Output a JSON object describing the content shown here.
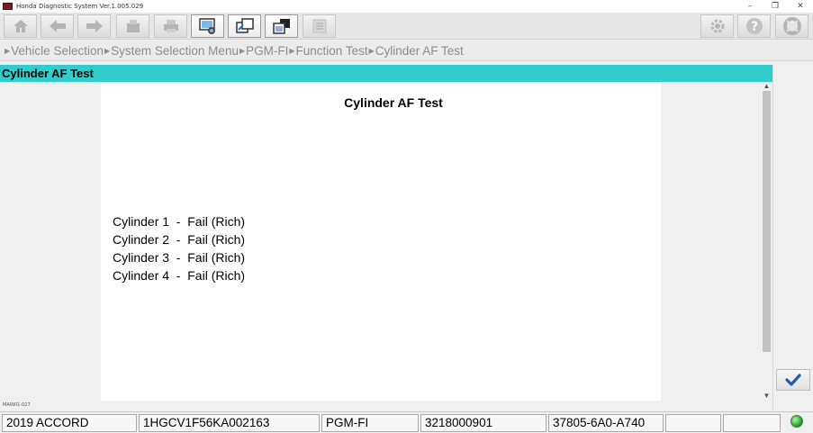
{
  "window": {
    "title": "Honda Diagnostic System Ver.1.005.029",
    "controls": [
      "–",
      "❐",
      "✕"
    ]
  },
  "toolbar": {
    "buttons": [
      {
        "name": "home-button",
        "icon": "home-icon"
      },
      {
        "name": "back-button",
        "icon": "arrow-left-icon"
      },
      {
        "name": "forward-button",
        "icon": "arrow-right-icon"
      },
      {
        "name": "save-button",
        "icon": "save-icon"
      },
      {
        "name": "print-button",
        "icon": "printer-icon"
      },
      {
        "name": "screenshot-button",
        "icon": "screen-capture-icon"
      },
      {
        "name": "switch-view-button",
        "icon": "window-switch-icon"
      },
      {
        "name": "window-stack-button",
        "icon": "window-stack-icon"
      },
      {
        "name": "data-button",
        "icon": "data-grid-icon"
      },
      {
        "name": "settings-button",
        "icon": "gear-icon"
      },
      {
        "name": "help-button",
        "icon": "help-icon"
      },
      {
        "name": "exit-button",
        "icon": "lifebuoy-icon"
      }
    ]
  },
  "breadcrumb": [
    "Vehicle Selection",
    "System Selection Menu",
    "PGM-FI",
    "Function Test",
    "Cylinder AF Test"
  ],
  "section_header": "Cylinder AF Test",
  "panel_code": "MAIN01-027",
  "content": {
    "title": "Cylinder AF Test",
    "results": [
      "Cylinder 1  -  Fail (Rich)",
      "Cylinder 2  -  Fail (Rich)",
      "Cylinder 3  -  Fail (Rich)",
      "Cylinder 4  -  Fail (Rich)"
    ]
  },
  "ok_button_icon": "checkmark-icon",
  "status_bar": {
    "model": "2019 ACCORD",
    "vin": "1HGCV1F56KA002163",
    "system": "PGM-FI",
    "ecu_id": "3218000901",
    "software": "37805-6A0-A740",
    "empty1": "",
    "empty2": "",
    "connection_color": "#2fa82f"
  },
  "colors": {
    "accent": "#33cccc",
    "ok_check": "#1f5fa8"
  }
}
